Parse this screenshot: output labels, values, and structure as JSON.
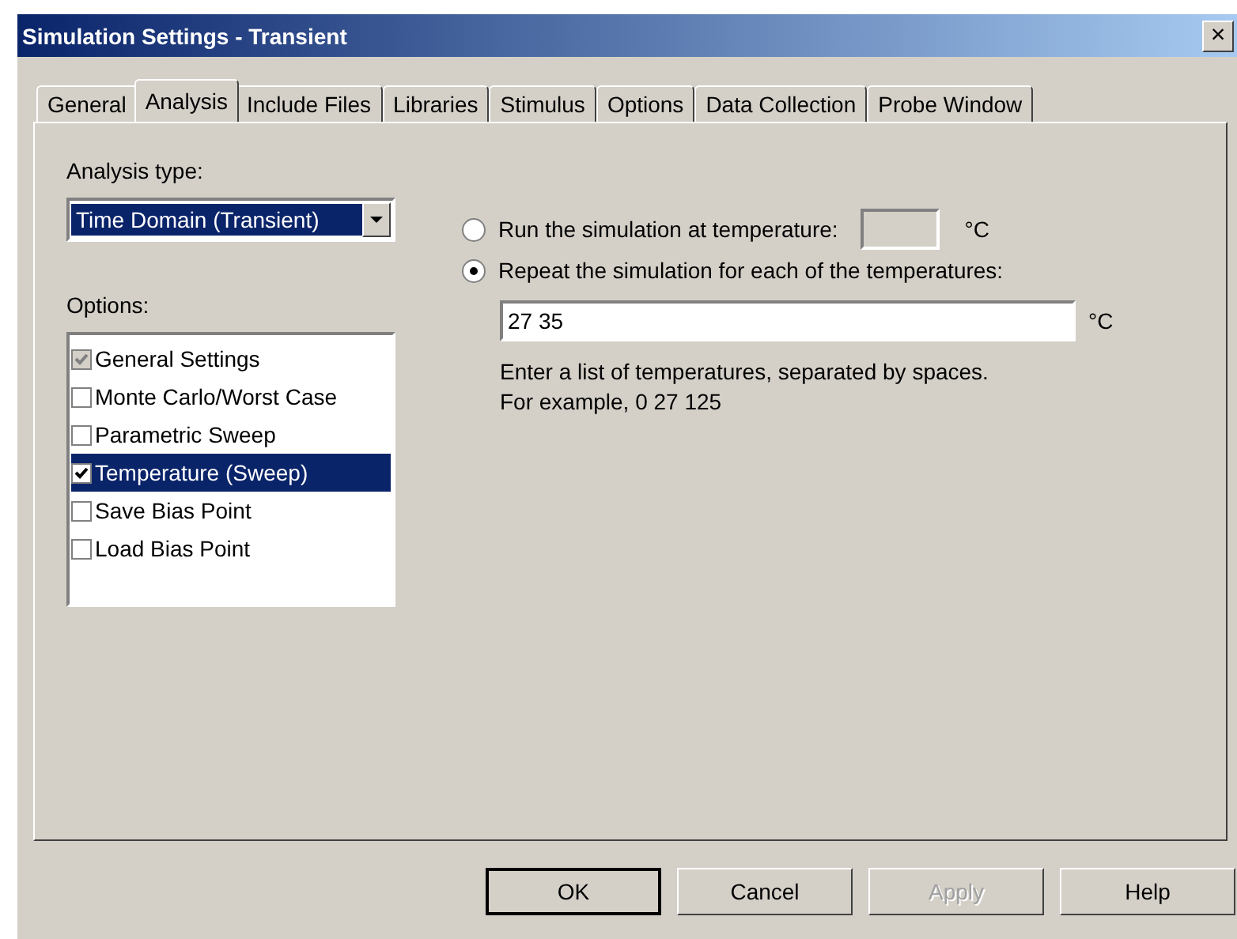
{
  "window": {
    "title": "Simulation Settings - Transient",
    "close": "×"
  },
  "tabs": [
    {
      "label": "General",
      "selected": false
    },
    {
      "label": "Analysis",
      "selected": true
    },
    {
      "label": "Include Files",
      "selected": false
    },
    {
      "label": "Libraries",
      "selected": false
    },
    {
      "label": "Stimulus",
      "selected": false
    },
    {
      "label": "Options",
      "selected": false
    },
    {
      "label": "Data Collection",
      "selected": false
    },
    {
      "label": "Probe Window",
      "selected": false
    }
  ],
  "analysis_type": {
    "label": "Analysis type:",
    "value": "Time Domain (Transient)"
  },
  "options": {
    "label": "Options:",
    "items": [
      {
        "label": "General Settings",
        "checked": true,
        "disabled": true,
        "selected": false
      },
      {
        "label": "Monte Carlo/Worst Case",
        "checked": false,
        "disabled": false,
        "selected": false
      },
      {
        "label": "Parametric Sweep",
        "checked": false,
        "disabled": false,
        "selected": false
      },
      {
        "label": "Temperature (Sweep)",
        "checked": true,
        "disabled": false,
        "selected": true
      },
      {
        "label": "Save Bias Point",
        "checked": false,
        "disabled": false,
        "selected": false
      },
      {
        "label": "Load Bias Point",
        "checked": false,
        "disabled": false,
        "selected": false
      }
    ]
  },
  "temperature": {
    "run_at": {
      "label": "Run the simulation at temperature:",
      "selected": false,
      "unit": "°C"
    },
    "repeat": {
      "label": "Repeat the simulation for each of the temperatures:",
      "selected": true,
      "value": "27 35",
      "unit": "°C"
    },
    "hint": [
      "Enter a list of temperatures, separated by spaces.",
      "For example, 0  27  125"
    ]
  },
  "buttons": [
    {
      "label": "OK",
      "default": true,
      "disabled": false
    },
    {
      "label": "Cancel",
      "default": false,
      "disabled": false
    },
    {
      "label": "Apply",
      "default": false,
      "disabled": true
    },
    {
      "label": "Help",
      "default": false,
      "disabled": false
    }
  ]
}
